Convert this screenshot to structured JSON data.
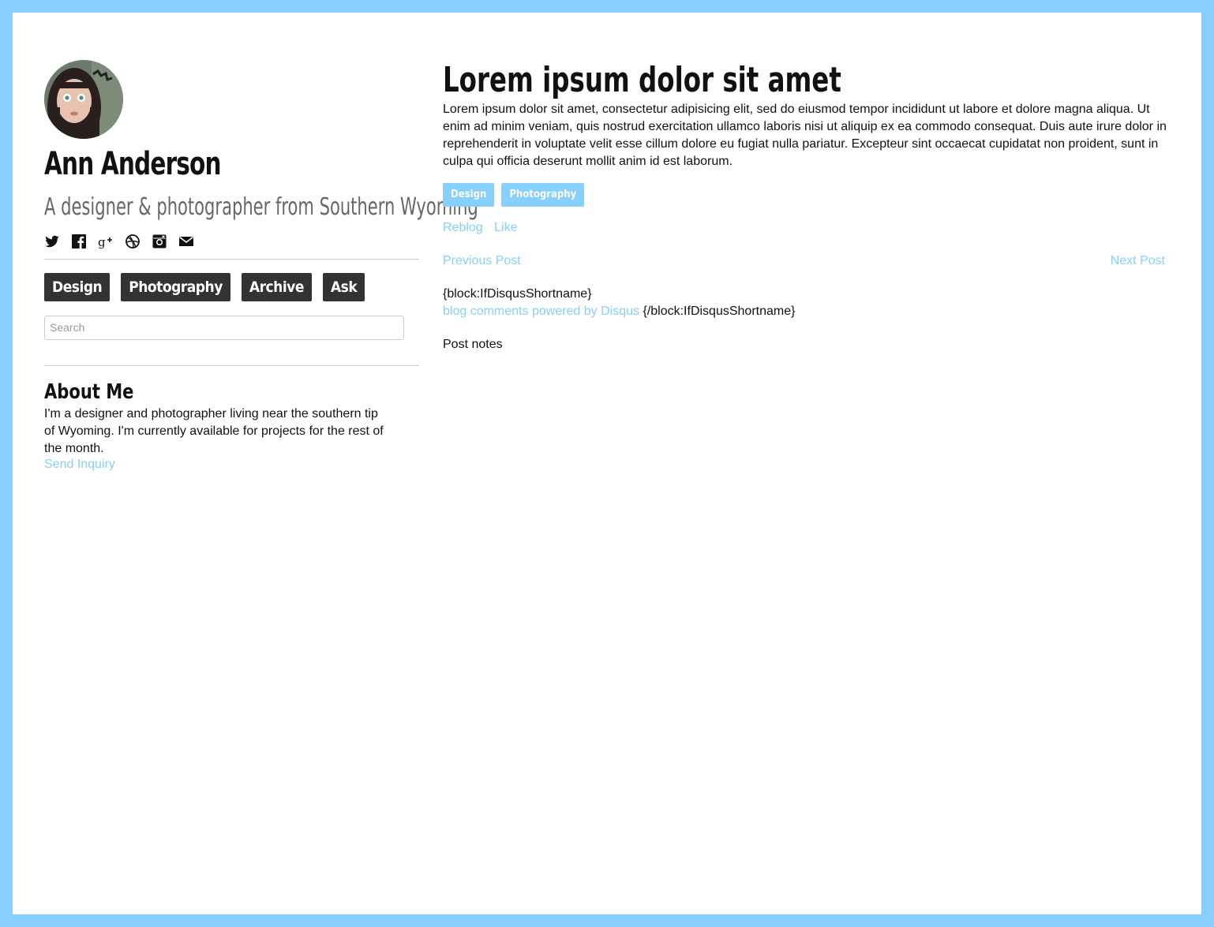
{
  "colors": {
    "accent": "#86cffe",
    "nav_bg": "#333333"
  },
  "profile": {
    "name": "Ann Anderson",
    "tagline": "A designer & photographer from Southern Wyoming"
  },
  "social": [
    "twitter-icon",
    "facebook-icon",
    "google-plus-icon",
    "dribbble-icon",
    "instagram-icon",
    "mail-icon"
  ],
  "nav": {
    "items": [
      "Design",
      "Photography",
      "Archive",
      "Ask"
    ]
  },
  "search": {
    "placeholder": "Search"
  },
  "about": {
    "title": "About Me",
    "text": "I'm a designer and photographer living near the southern tip of Wyoming. I'm currently available for projects for the rest of the month.",
    "link": "Send Inquiry"
  },
  "post": {
    "title": "Lorem ipsum dolor sit amet",
    "body": "Lorem ipsum dolor sit amet, consectetur adipisicing elit, sed do eiusmod tempor incididunt ut labore et dolore magna aliqua. Ut enim ad minim veniam, quis nostrud exercitation ullamco laboris nisi ut aliquip ex ea commodo consequat. Duis aute irure dolor in reprehenderit in voluptate velit esse cillum dolore eu fugiat nulla pariatur. Excepteur sint occaecat cupidatat non proident, sunt in culpa qui officia deserunt mollit anim id est laborum.",
    "tags": [
      "Design",
      "Photography"
    ],
    "reblog": "Reblog",
    "like": "Like",
    "prev": "Previous Post",
    "next": "Next Post",
    "disqus_open": "{block:IfDisqusShortname}",
    "disqus_link": "blog comments powered by Disqus",
    "disqus_close": "{/block:IfDisqusShortname}",
    "notes": "Post notes"
  }
}
